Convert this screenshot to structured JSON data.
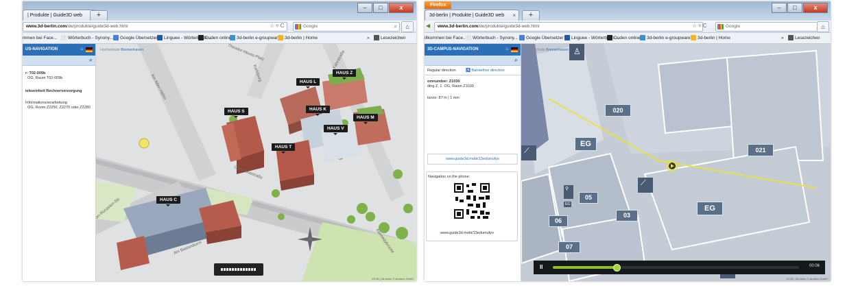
{
  "left": {
    "tab_title": "| Produkte | Guide3D web",
    "new_tab": "+",
    "url_host": "www.3d-berlin.com",
    "url_path": "/de/produkte/guide3d-web.html",
    "search_placeholder": "Google",
    "bookmarks": [
      "mmen bei Face...",
      "Wörterbuch - Synony...",
      "Google Übersetzer",
      "Linguee - Wörterbuch ...",
      "Duden online",
      "3d-berlin e-groupware...",
      "3d-berlin | Home"
    ],
    "bookmarks_more": "»",
    "bookmarks_folder": "Lesezeichen",
    "sidebar": {
      "header": "US-NAVIGATION",
      "room_label": "r: T02-009b",
      "room_detail": ". OG, Raum T02-009b",
      "dept_title": "iebseinheit Rechnerversorgung",
      "dept_line1": "Informationsverarbeitung",
      "dept_line2": ". OG, Room Z2250, Z2270 oder Z2280"
    },
    "map": {
      "logo_prefix": "Hochschule",
      "logo_name": "Bremerhaven",
      "buildings": [
        "HAUS L",
        "HAUS Z",
        "HAUS S",
        "HAUS K",
        "HAUS M",
        "HAUS V",
        "HAUS T",
        "HAUS C"
      ],
      "streets": [
        "Theodor-Heuss-Platz",
        "Am Alten Hafen",
        "Columbusstraße",
        "Fährstraße",
        "Karlsburg",
        "Van-Ronzelen-Str.",
        "Am Bastardturm",
        "Kennedybrücke"
      ],
      "copyright": "V3.36 | 3d-berlin © sindbox GmbH"
    }
  },
  "right": {
    "firefox_label": "Firefox",
    "tab_title": "3d-berlin | Produkte | Guide3D web",
    "new_tab": "+",
    "url_host": "www.3d-berlin.com",
    "url_path": "/de/produkte/guide3d-web.html",
    "search_placeholder": "Google",
    "bookmarks": [
      "illkommen bei Face...",
      "Wörterbuch - Synony...",
      "Google Übersetzer",
      "Linguee - Wörterbuch ...",
      "Duden online",
      "3d-berlin e-groupware...",
      "3d-berlin | Home"
    ],
    "bookmarks_more": "»",
    "bookmarks_folder": "Lesezeichen",
    "sidebar": {
      "header": "3D-CAMPUS-NAVIGATION",
      "tab_regular": "Regular direction",
      "tab_barrierfree": "Barrierfree direction",
      "room_label": "omnumber: Z1030",
      "room_detail": "ding Z, 1. OG, Raum Z1030",
      "distance": "tance: 87 m | 1 min",
      "link": "www.guide3d.mobi/13edumufyo",
      "phone_label": "Navigation on the phone:",
      "qr_caption": "www.guide3d.mobi/13edumufyo"
    },
    "map": {
      "logo_prefix": "Hochschule",
      "logo_name": "Bremerhaven",
      "rooms": [
        "020",
        "EG",
        "021",
        "05",
        "EG",
        "03",
        "06",
        "07"
      ],
      "wc_label": "EG",
      "player_time": "00:06",
      "progress": 0.26,
      "copyright": "V3.36 | 3d-berlin © sindbox GmbH"
    }
  }
}
